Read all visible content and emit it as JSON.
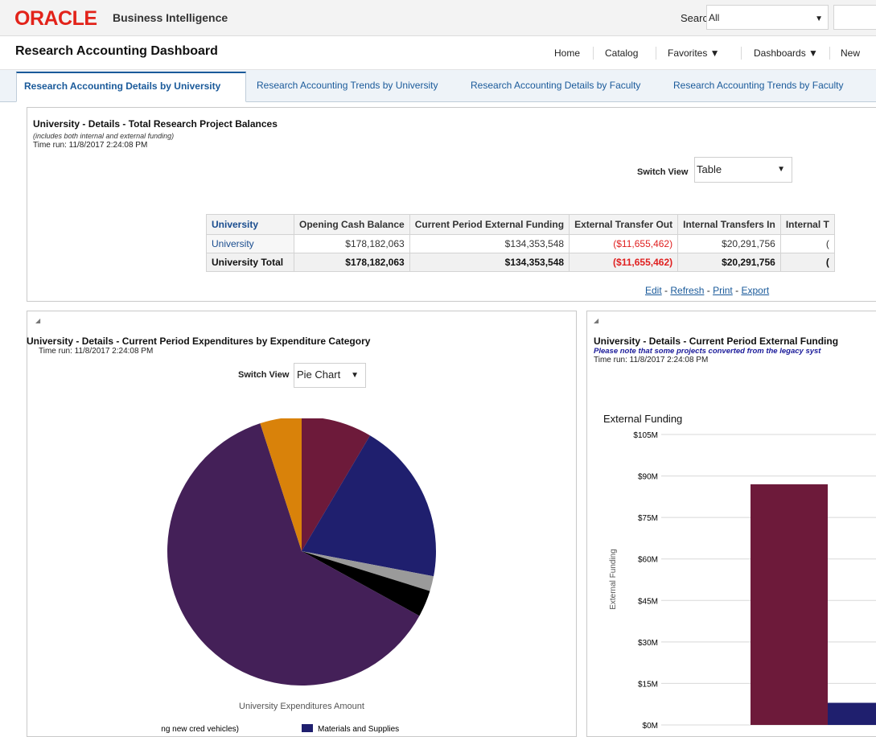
{
  "header": {
    "logo_text": "ORACLE",
    "product": "Business Intelligence",
    "search_label": "Search",
    "search_scope": "All",
    "dashboard_title": "Research Accounting Dashboard",
    "nav": [
      "Home",
      "Catalog",
      "Favorites ▼",
      "Dashboards ▼",
      "New"
    ]
  },
  "tabs": [
    "Research Accounting Details by University",
    "Research Accounting Trends by University",
    "Research Accounting Details by Faculty",
    "Research Accounting Trends by Faculty"
  ],
  "balances_panel": {
    "title": "University - Details - Total Research Project Balances",
    "note": "(includes both internal and external funding)",
    "time_run": "Time run: 11/8/2017 2:24:08 PM",
    "switch_label": "Switch View",
    "switch_value": "Table",
    "table": {
      "headers": [
        "University",
        "Opening Cash Balance",
        "Current Period External Funding",
        "External Transfer Out",
        "Internal Transfers In",
        "Internal T"
      ],
      "rows": [
        [
          "University",
          "$178,182,063",
          "$134,353,548",
          "($11,655,462)",
          "$20,291,756",
          "("
        ]
      ],
      "total": [
        "University Total",
        "$178,182,063",
        "$134,353,548",
        "($11,655,462)",
        "$20,291,756",
        "("
      ]
    },
    "actions": {
      "edit": "Edit",
      "refresh": "Refresh",
      "print": "Print",
      "export": "Export",
      "sep": "-"
    }
  },
  "expenditures_panel": {
    "corner": "◢",
    "title": "University - Details - Current Period Expenditures by Expenditure Category",
    "time_run": "Time run: 11/8/2017 2:24:08 PM",
    "switch_label": "Switch View",
    "switch_value": "Pie Chart",
    "legend": [
      "Equipment (including new cred vehicles)",
      "Materials and Supplies"
    ]
  },
  "funding_panel": {
    "corner": "◢",
    "title": "University - Details - Current Period External Funding",
    "note": "Please note that some projects converted from the legacy syst",
    "time_run": "Time run: 11/8/2017 2:24:08 PM"
  },
  "colors": {
    "oracle_red": "#e2231a",
    "link_blue": "#1a5a9a",
    "negative_red": "#e02020",
    "maroon": "#6d1a3a",
    "navy": "#1f1f6e",
    "purple": "#442058",
    "gold": "#d9820a",
    "black": "#000000",
    "gray": "#9a9a9a"
  },
  "chart_data": [
    {
      "type": "pie",
      "title": "",
      "xlabel": "University Expenditures Amount",
      "categories": [
        "Equipment (including new cred vehicles)",
        "Materials and Supplies",
        "Gray category",
        "Black category",
        "Purple category",
        "Gold category"
      ],
      "values": [
        8.5,
        19.5,
        1.8,
        3.2,
        62.0,
        5.0
      ]
    },
    {
      "type": "bar",
      "title": "External Funding",
      "ylabel": "External Funding",
      "ylim": [
        0,
        105
      ],
      "yticks": [
        "$0M",
        "$15M",
        "$30M",
        "$45M",
        "$60M",
        "$75M",
        "$90M",
        "$105M"
      ],
      "series": [
        {
          "values": [
            87
          ]
        },
        {
          "values": [
            8
          ]
        }
      ]
    }
  ]
}
